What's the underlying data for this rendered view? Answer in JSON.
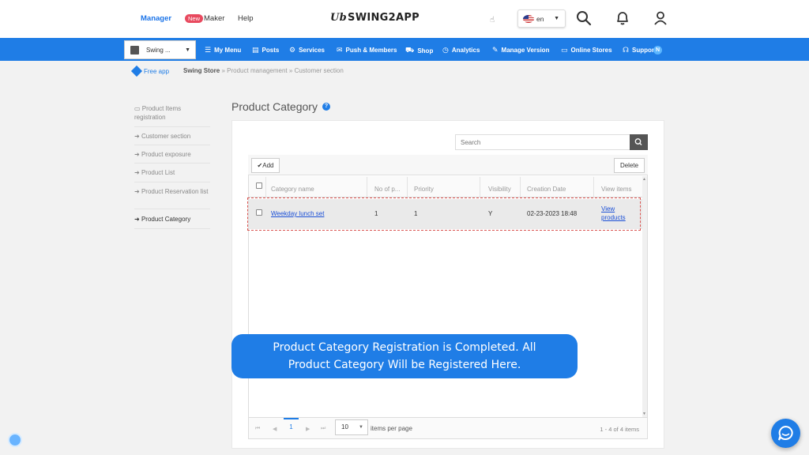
{
  "topbar": {
    "nav": {
      "manager": "Manager",
      "new_badge": "New",
      "maker": "Maker",
      "help": "Help"
    },
    "logo": {
      "script": "Ub",
      "text": "SWING2APP"
    },
    "language": "en",
    "icons": [
      "search-icon",
      "bell-icon",
      "user-icon",
      "hand-icon"
    ]
  },
  "menubar": {
    "app_select": "Swing ...",
    "items": [
      "My Menu",
      "Posts",
      "Services",
      "Push & Members",
      "Shop",
      "Analytics",
      "Manage Version",
      "Online Stores",
      "Suppor"
    ],
    "support_badge": "N"
  },
  "breadcrumb": {
    "free_app": "Free app",
    "path": [
      "Swing Store",
      "Product management",
      "Customer section"
    ],
    "separator": "»"
  },
  "sidebar": {
    "items": [
      {
        "label": "Product Items registration",
        "active": false
      },
      {
        "label": "Customer section",
        "active": false
      },
      {
        "label": "Product exposure",
        "active": false
      },
      {
        "label": "Product List",
        "active": false
      },
      {
        "label": "Product Reservation list",
        "active": false
      },
      {
        "label": "Product Category",
        "active": true
      }
    ]
  },
  "main": {
    "title": "Product Category",
    "help_icon": "?",
    "search_placeholder": "Search",
    "add_label": "Add",
    "delete_label": "Delete",
    "columns": [
      "Category name",
      "No of p...",
      "Priority",
      "Visibility",
      "Creation Date",
      "View items"
    ],
    "rows": [
      {
        "category_name": "Weekday lunch set",
        "no_of_products": "1",
        "priority": "1",
        "visibility": "Y",
        "creation_date": "02-23-2023 18:48",
        "view_items": "View products"
      }
    ],
    "pager": {
      "current_page": "1",
      "page_size": "10",
      "per_page_label": "items per page",
      "info": "1 - 4 of 4 items"
    }
  },
  "callout": {
    "line1": "Product Category Registration is Completed. All",
    "line2": "Product Category Will be Registered Here."
  },
  "colors": {
    "brand_blue": "#1f7de6",
    "highlight_border": "#d9534f",
    "new_badge": "#e84a5f"
  }
}
